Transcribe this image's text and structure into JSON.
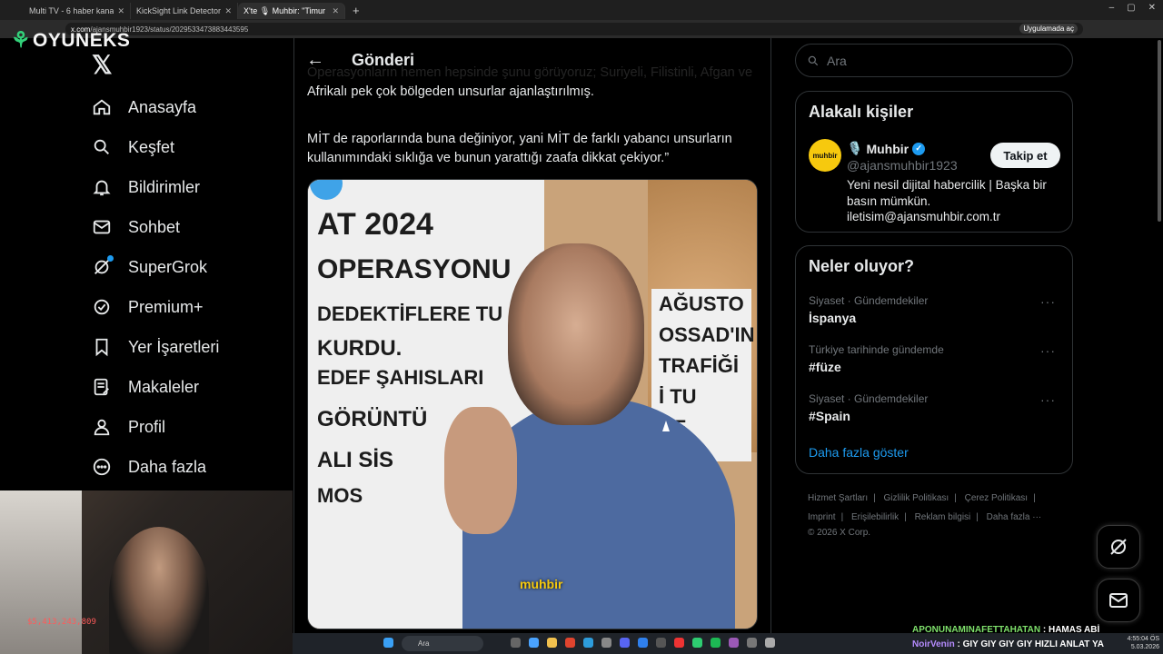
{
  "browser": {
    "tabs": [
      {
        "label": "Multi TV - 6 haber kanalını aynı...",
        "active": false
      },
      {
        "label": "KickSight Link Detector",
        "active": false
      },
      {
        "label": "X'te 🎙 Muhbir: \"Timur Sö...",
        "active": true
      }
    ],
    "url_domain": "x.com",
    "url_path": "/ajansmuhbir1923/status/2029533473883443595",
    "install_chip": "Uygulamada aç"
  },
  "overlay_logo": "OYUNEKS",
  "sidebar": {
    "items": [
      {
        "label": "Anasayfa",
        "icon": "home-icon"
      },
      {
        "label": "Keşfet",
        "icon": "search-icon"
      },
      {
        "label": "Bildirimler",
        "icon": "bell-icon"
      },
      {
        "label": "Sohbet",
        "icon": "mail-icon"
      },
      {
        "label": "SuperGrok",
        "icon": "grok-icon"
      },
      {
        "label": "Premium+",
        "icon": "verified-icon"
      },
      {
        "label": "Yer İşaretleri",
        "icon": "bookmark-icon"
      },
      {
        "label": "Makaleler",
        "icon": "article-icon"
      },
      {
        "label": "Profil",
        "icon": "person-icon"
      },
      {
        "label": "Daha fazla",
        "icon": "more-circle-icon"
      }
    ]
  },
  "webcam": {
    "counter": "$5,413,243,809"
  },
  "post": {
    "header_title": "Gönderi",
    "text_partial": "Operasyonların hemen hepsinde şunu görüyoruz; Suriyeli, Filistinli, Afgan ve Afrikalı pek çok bölgeden unsurlar ajanlaştırılmış.",
    "text_2": "MİT de raporlarında buna değiniyor, yani MİT de farklı yabancı unsurların kullanımındaki sıklığa ve bunun yarattığı zaafa dikkat çekiyor.”",
    "media_board_lines": [
      "AT 2024",
      "OPERASYONU",
      "DEDEKTİFLERE TU",
      "KURDU.",
      "EDEF ŞAHISLARI",
      "GÖRÜNTÜ",
      "ALI SİS",
      "MOS"
    ],
    "media_board_right": [
      "AĞUSTO",
      "OSSAD'IN",
      "TRAFİĞİ",
      "İ TU",
      "CE"
    ],
    "media_watermark": "muhbir"
  },
  "right": {
    "search_placeholder": "Ara",
    "related_title": "Alakalı kişiler",
    "profile": {
      "emoji": "🎙️",
      "name": "Muhbir",
      "handle": "@ajansmuhbir1923",
      "bio": "Yeni nesil dijital habercilik | Başka bir basın mümkün. iletisim@ajansmuhbir.com.tr",
      "follow_label": "Takip et",
      "avatar_text": "muhbir"
    },
    "trends_title": "Neler oluyor?",
    "trends": [
      {
        "context": "Siyaset · Gündemdekiler",
        "title": "İspanya"
      },
      {
        "context": "Türkiye tarihinde gündemde",
        "title": "#füze"
      },
      {
        "context": "Siyaset · Gündemdekiler",
        "title": "#Spain"
      }
    ],
    "show_more": "Daha fazla göster",
    "footer_links": [
      "Hizmet Şartları",
      "Gizlilik Politikası",
      "Çerez Politikası",
      "Imprint",
      "Erişilebilirlik",
      "Reklam bilgisi",
      "Daha fazla ···"
    ],
    "copyright": "© 2026 X Corp."
  },
  "taskbar": {
    "search_label": "Ara",
    "time": "4:55:04 ÖS",
    "date": "5.03.2026"
  },
  "chat": [
    {
      "user": "APONUNAMINAFETTAHATAN",
      "message": " : HAMAS ABİ"
    },
    {
      "user": "NoirVenin",
      "message": " : GIY GIY GIY GIY HIZLI ANLAT YA"
    }
  ]
}
